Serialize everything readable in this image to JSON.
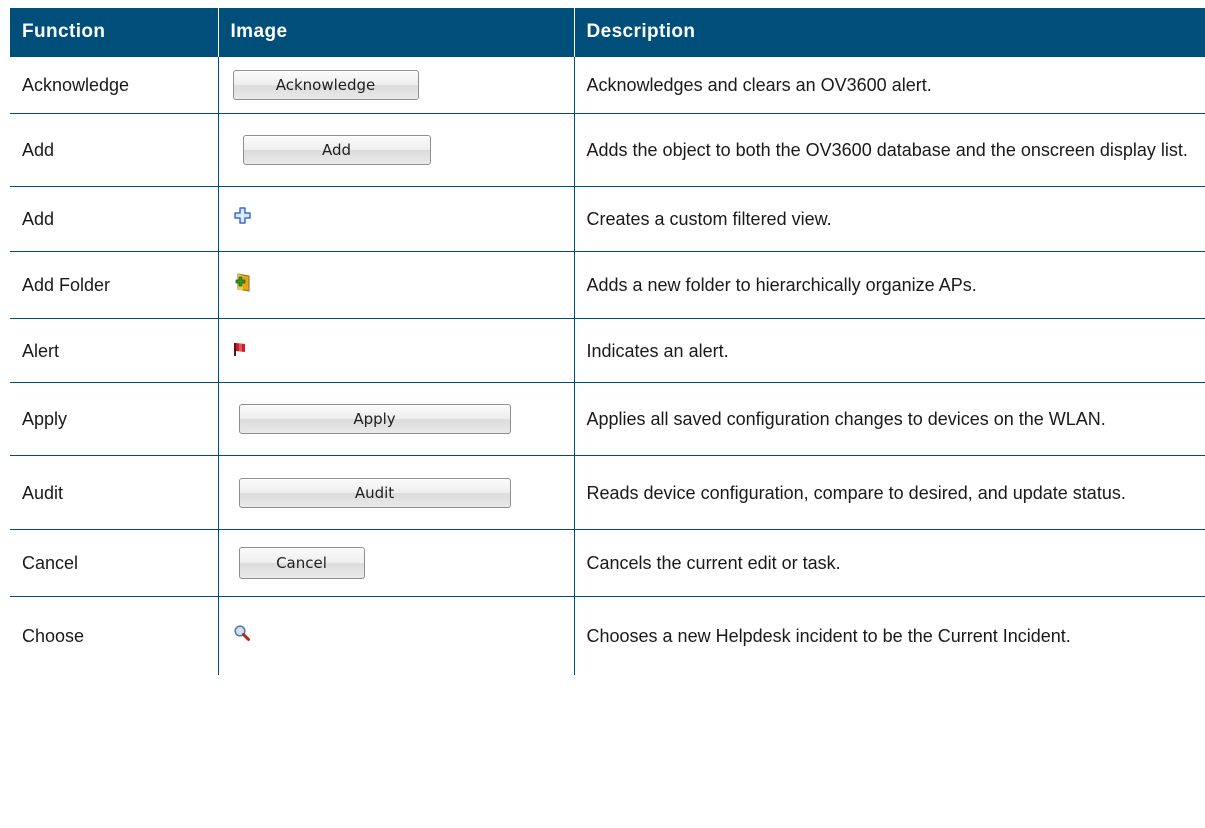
{
  "header": {
    "function": "Function",
    "image": "Image",
    "description": "Description"
  },
  "rows": [
    {
      "function": "Acknowledge",
      "button": "Acknowledge",
      "description": "Acknowledges and clears an OV3600 alert."
    },
    {
      "function": "Add",
      "button": "Add",
      "description": "Adds the object to both the OV3600 database and the onscreen display list."
    },
    {
      "function": "Add",
      "icon": "plus-icon",
      "description": "Creates a custom filtered view."
    },
    {
      "function": "Add Folder",
      "icon": "add-folder-icon",
      "description": "Adds a new folder to hierarchically organize APs."
    },
    {
      "function": "Alert",
      "icon": "red-flag-icon",
      "description": "Indicates an alert."
    },
    {
      "function": "Apply",
      "button": "Apply",
      "description": "Applies all saved configuration changes to devices on the WLAN."
    },
    {
      "function": "Audit",
      "button": "Audit",
      "description": "Reads device configuration, compare to desired, and update status."
    },
    {
      "function": "Cancel",
      "button": "Cancel",
      "description": "Cancels the current edit or task."
    },
    {
      "function": "Choose",
      "icon": "magnifier-icon",
      "description": "Chooses a new Helpdesk incident to be the Current Incident."
    }
  ]
}
